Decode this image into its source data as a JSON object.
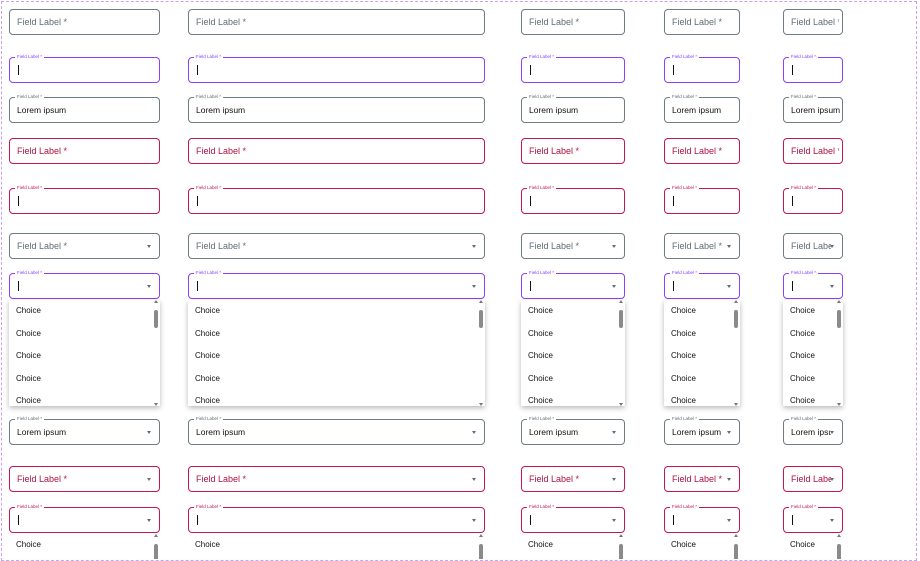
{
  "labels": {
    "field": "Field Label *",
    "value": "Lorem ipsum"
  },
  "options": [
    "Choice",
    "Choice",
    "Choice",
    "Choice",
    "Choice"
  ],
  "colors": {
    "neutral_border": "#6f7c82",
    "focus_border": "#8a3ffc",
    "error_border": "#c4174b",
    "error_text": "#b0103f",
    "placeholder_text": "#5f6d74"
  },
  "columns": [
    "full-width",
    "wide",
    "medium",
    "small",
    "compact"
  ],
  "rows": [
    {
      "kind": "text",
      "state": "default"
    },
    {
      "kind": "text",
      "state": "focused"
    },
    {
      "kind": "text",
      "state": "filled"
    },
    {
      "kind": "text",
      "state": "error"
    },
    {
      "kind": "text",
      "state": "error-focused"
    },
    {
      "kind": "select",
      "state": "default"
    },
    {
      "kind": "select",
      "state": "focused-open"
    },
    {
      "kind": "select",
      "state": "filled"
    },
    {
      "kind": "select",
      "state": "error"
    },
    {
      "kind": "select",
      "state": "error-focused-open"
    }
  ]
}
